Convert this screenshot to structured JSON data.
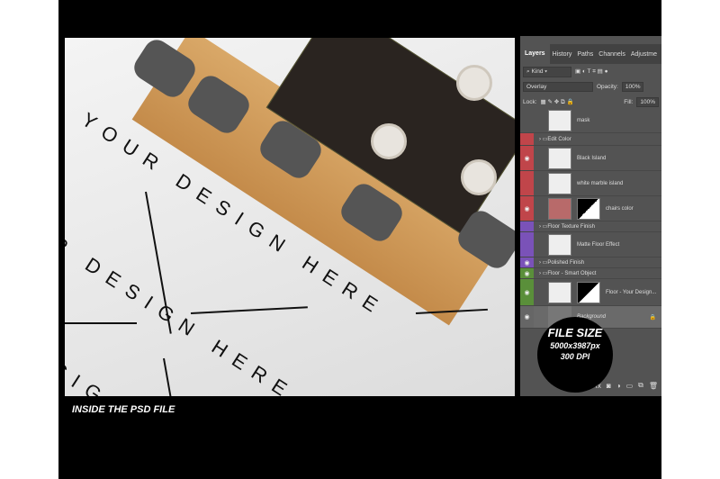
{
  "caption": "INSIDE THE PSD FILE",
  "design_text": [
    "YOUR DESIGN HERE",
    "R DESIGN HERE",
    "SIGN H"
  ],
  "panel": {
    "tabs": [
      "Layers",
      "History",
      "Paths",
      "Channels",
      "Adjustme"
    ],
    "filter": "Kind",
    "blend_mode": "Overlay",
    "opacity_label": "Opacity:",
    "opacity": "100%",
    "lock_label": "Lock:",
    "fill_label": "Fill:",
    "fill": "100%",
    "layers": [
      {
        "name": "mask",
        "color": "#535353",
        "visible": false,
        "type": "layer"
      },
      {
        "name": "Edit Color",
        "color": "#c0454a",
        "visible": false,
        "type": "group"
      },
      {
        "name": "Black Island",
        "color": "#c0454a",
        "visible": true,
        "type": "layer"
      },
      {
        "name": "white marble island",
        "color": "#c0454a",
        "visible": false,
        "type": "layer"
      },
      {
        "name": "chairs color",
        "color": "#c0454a",
        "visible": true,
        "type": "fill"
      },
      {
        "name": "Floor Texture Finish",
        "color": "#7a52b8",
        "visible": false,
        "type": "group"
      },
      {
        "name": "Matte Floor Effect",
        "color": "#7a52b8",
        "visible": false,
        "type": "layer"
      },
      {
        "name": "Polished Finish",
        "color": "#7a52b8",
        "visible": true,
        "type": "group"
      },
      {
        "name": "Floor - Smart Object",
        "color": "#5a8f3a",
        "visible": true,
        "type": "group"
      },
      {
        "name": "Floor - Your Design...",
        "color": "#5a8f3a",
        "visible": true,
        "type": "smart"
      },
      {
        "name": "Background",
        "color": "#666666",
        "visible": true,
        "type": "background"
      }
    ]
  },
  "badge": {
    "title": "FILE SIZE",
    "dims": "5000x3987px",
    "dpi": "300 DPI"
  }
}
